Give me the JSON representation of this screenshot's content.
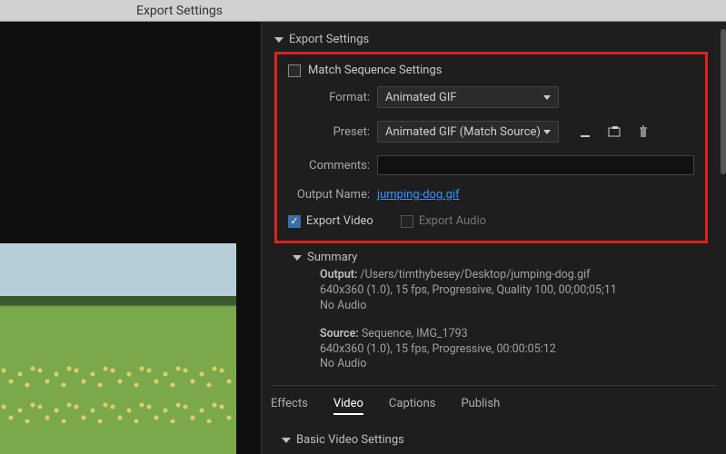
{
  "window": {
    "title": "Export Settings"
  },
  "section": {
    "title": "Export Settings"
  },
  "match_sequence": {
    "label": "Match Sequence Settings",
    "checked": false
  },
  "format": {
    "label": "Format:",
    "value": "Animated GIF"
  },
  "preset": {
    "label": "Preset:",
    "value": "Animated GIF (Match Source)"
  },
  "comments": {
    "label": "Comments:",
    "value": ""
  },
  "output_name": {
    "label": "Output Name:",
    "value": "jumping-dog.gif"
  },
  "export_video": {
    "label": "Export Video",
    "checked": true
  },
  "export_audio": {
    "label": "Export Audio",
    "checked": false
  },
  "summary": {
    "title": "Summary",
    "output_label": "Output:",
    "output_path": "/Users/timthybesey/Desktop/jumping-dog.gif",
    "output_spec": "640x360 (1.0), 15 fps, Progressive, Quality 100, 00;00;05;11",
    "output_audio": "No Audio",
    "source_label": "Source:",
    "source_seq": "Sequence, IMG_1793",
    "source_spec": "640x360 (1.0), 15 fps, Progressive, 00:00:05:12",
    "source_audio": "No Audio"
  },
  "tabs": {
    "effects": "Effects",
    "video": "Video",
    "captions": "Captions",
    "publish": "Publish",
    "active": "video"
  },
  "basic_video": {
    "title": "Basic Video Settings"
  },
  "icons": {
    "save_preset": "save-preset",
    "import_preset": "import-preset",
    "delete_preset": "delete-preset"
  }
}
